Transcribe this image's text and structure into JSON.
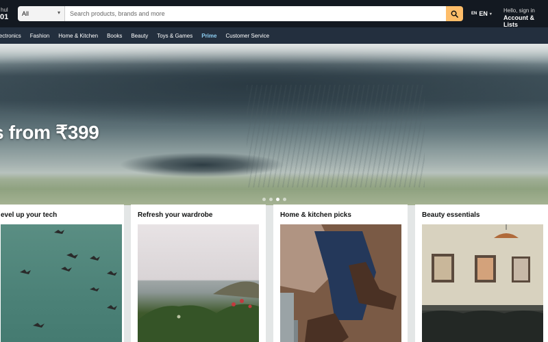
{
  "header": {
    "deliver_line1": "hul",
    "deliver_line2": "01",
    "search_category": "All",
    "search_placeholder": "Search products, brands and more",
    "lang_flag": "EN",
    "lang_label": "EN",
    "account_line1": "Hello, sign in",
    "account_line2": "Account & Lists"
  },
  "nav": {
    "items": [
      "lectronics",
      "Fashion",
      "Home & Kitchen",
      "Books",
      "Beauty",
      "Toys & Games",
      "Prime",
      "Customer Service"
    ]
  },
  "hero": {
    "title": "s from ₹399",
    "slide_count": 4,
    "active_slide": 2
  },
  "cards": [
    {
      "title": "evel up your tech"
    },
    {
      "title": "Refresh your wardrobe"
    },
    {
      "title": "Home & kitchen picks"
    },
    {
      "title": "Beauty essentials"
    }
  ],
  "colors": {
    "topbar": "#131921",
    "subnav": "#232f3e",
    "search_button": "#febd69",
    "prime": "#8ed0f4"
  }
}
